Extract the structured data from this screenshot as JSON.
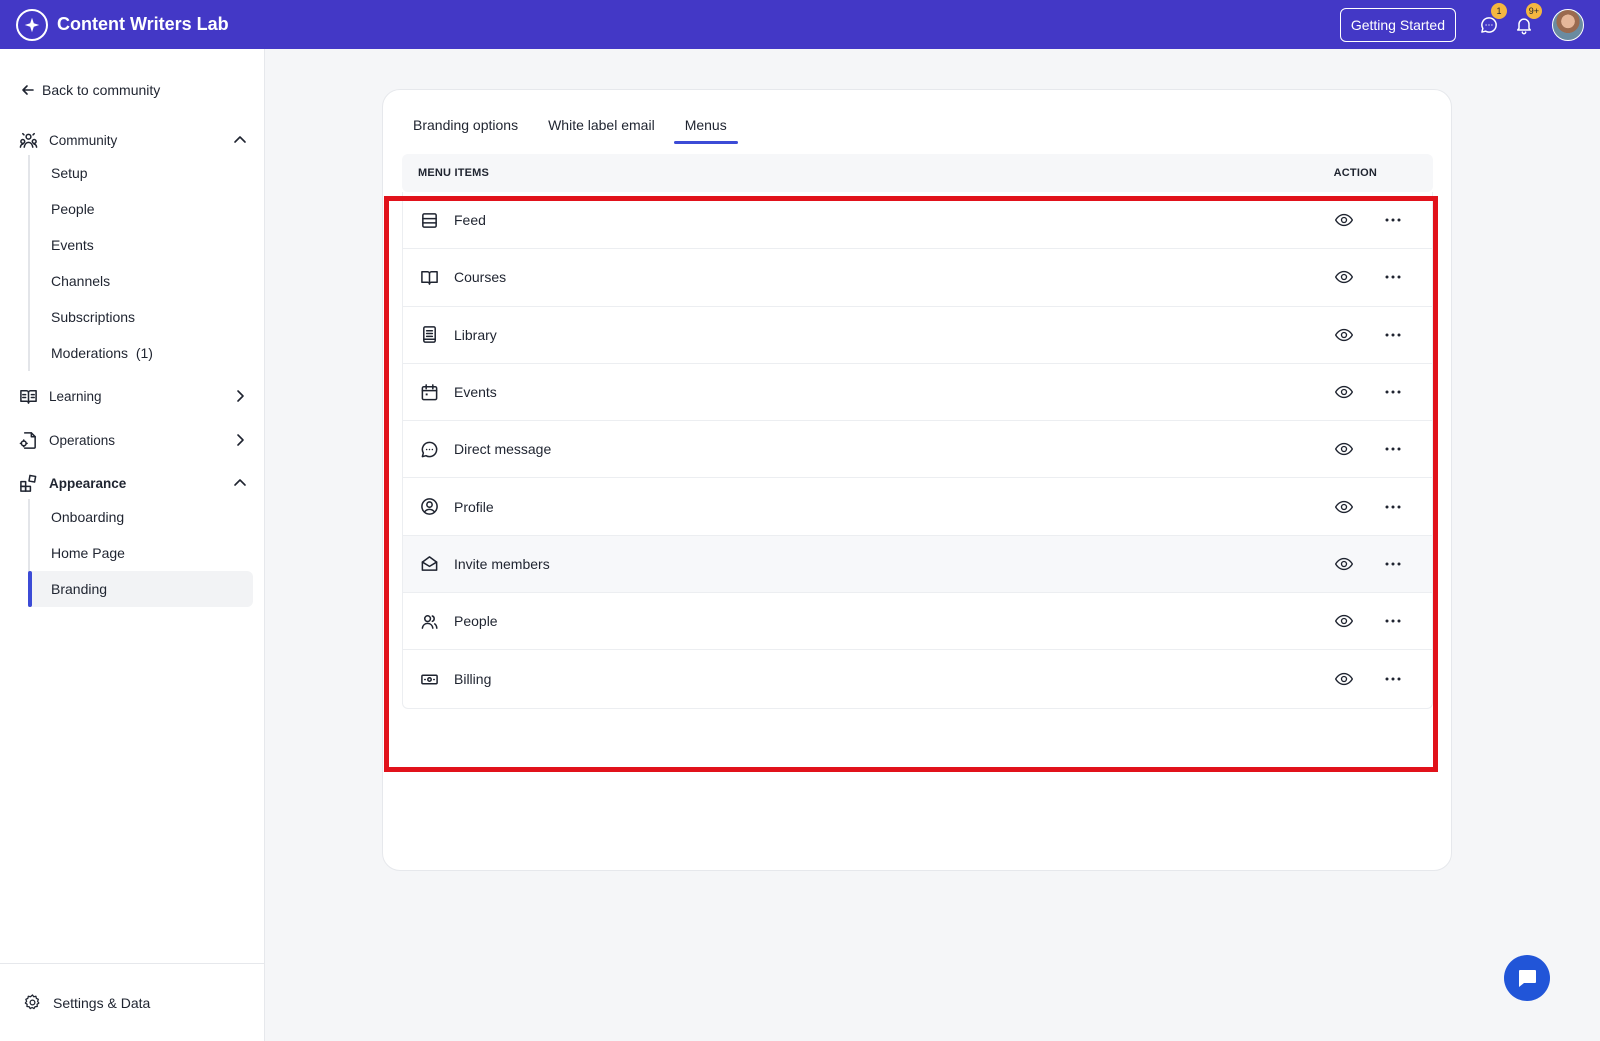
{
  "app": {
    "title": "Content Writers Lab"
  },
  "topbar": {
    "getting_started": "Getting Started",
    "messages_badge": "1",
    "notifications_badge": "9+"
  },
  "sidebar": {
    "back_label": "Back to community",
    "sections": {
      "community": {
        "label": "Community",
        "items": [
          "Setup",
          "People",
          "Events",
          "Channels",
          "Subscriptions",
          "Moderations  (1)"
        ]
      },
      "learning": {
        "label": "Learning"
      },
      "operations": {
        "label": "Operations"
      },
      "appearance": {
        "label": "Appearance",
        "items": [
          "Onboarding",
          "Home Page",
          "Branding"
        ],
        "active": "Branding"
      }
    },
    "settings_label": "Settings & Data"
  },
  "tabs": [
    "Branding options",
    "White label email",
    "Menus"
  ],
  "active_tab": "Menus",
  "table": {
    "col_items": "MENU ITEMS",
    "col_action": "ACTION",
    "rows": [
      {
        "label": "Feed",
        "icon": "feed-icon"
      },
      {
        "label": "Courses",
        "icon": "book-open-icon"
      },
      {
        "label": "Library",
        "icon": "library-icon"
      },
      {
        "label": "Events",
        "icon": "calendar-icon"
      },
      {
        "label": "Direct message",
        "icon": "chat-bubble-icon"
      },
      {
        "label": "Profile",
        "icon": "user-circle-icon"
      },
      {
        "label": "Invite members",
        "icon": "envelope-open-icon"
      },
      {
        "label": "People",
        "icon": "users-icon"
      },
      {
        "label": "Billing",
        "icon": "banknote-icon"
      }
    ]
  },
  "colors": {
    "brand": "#4338c6",
    "accent": "#3c4bd6",
    "highlight": "#e1121b",
    "badge": "#f4b740",
    "fab": "#2155d8"
  }
}
